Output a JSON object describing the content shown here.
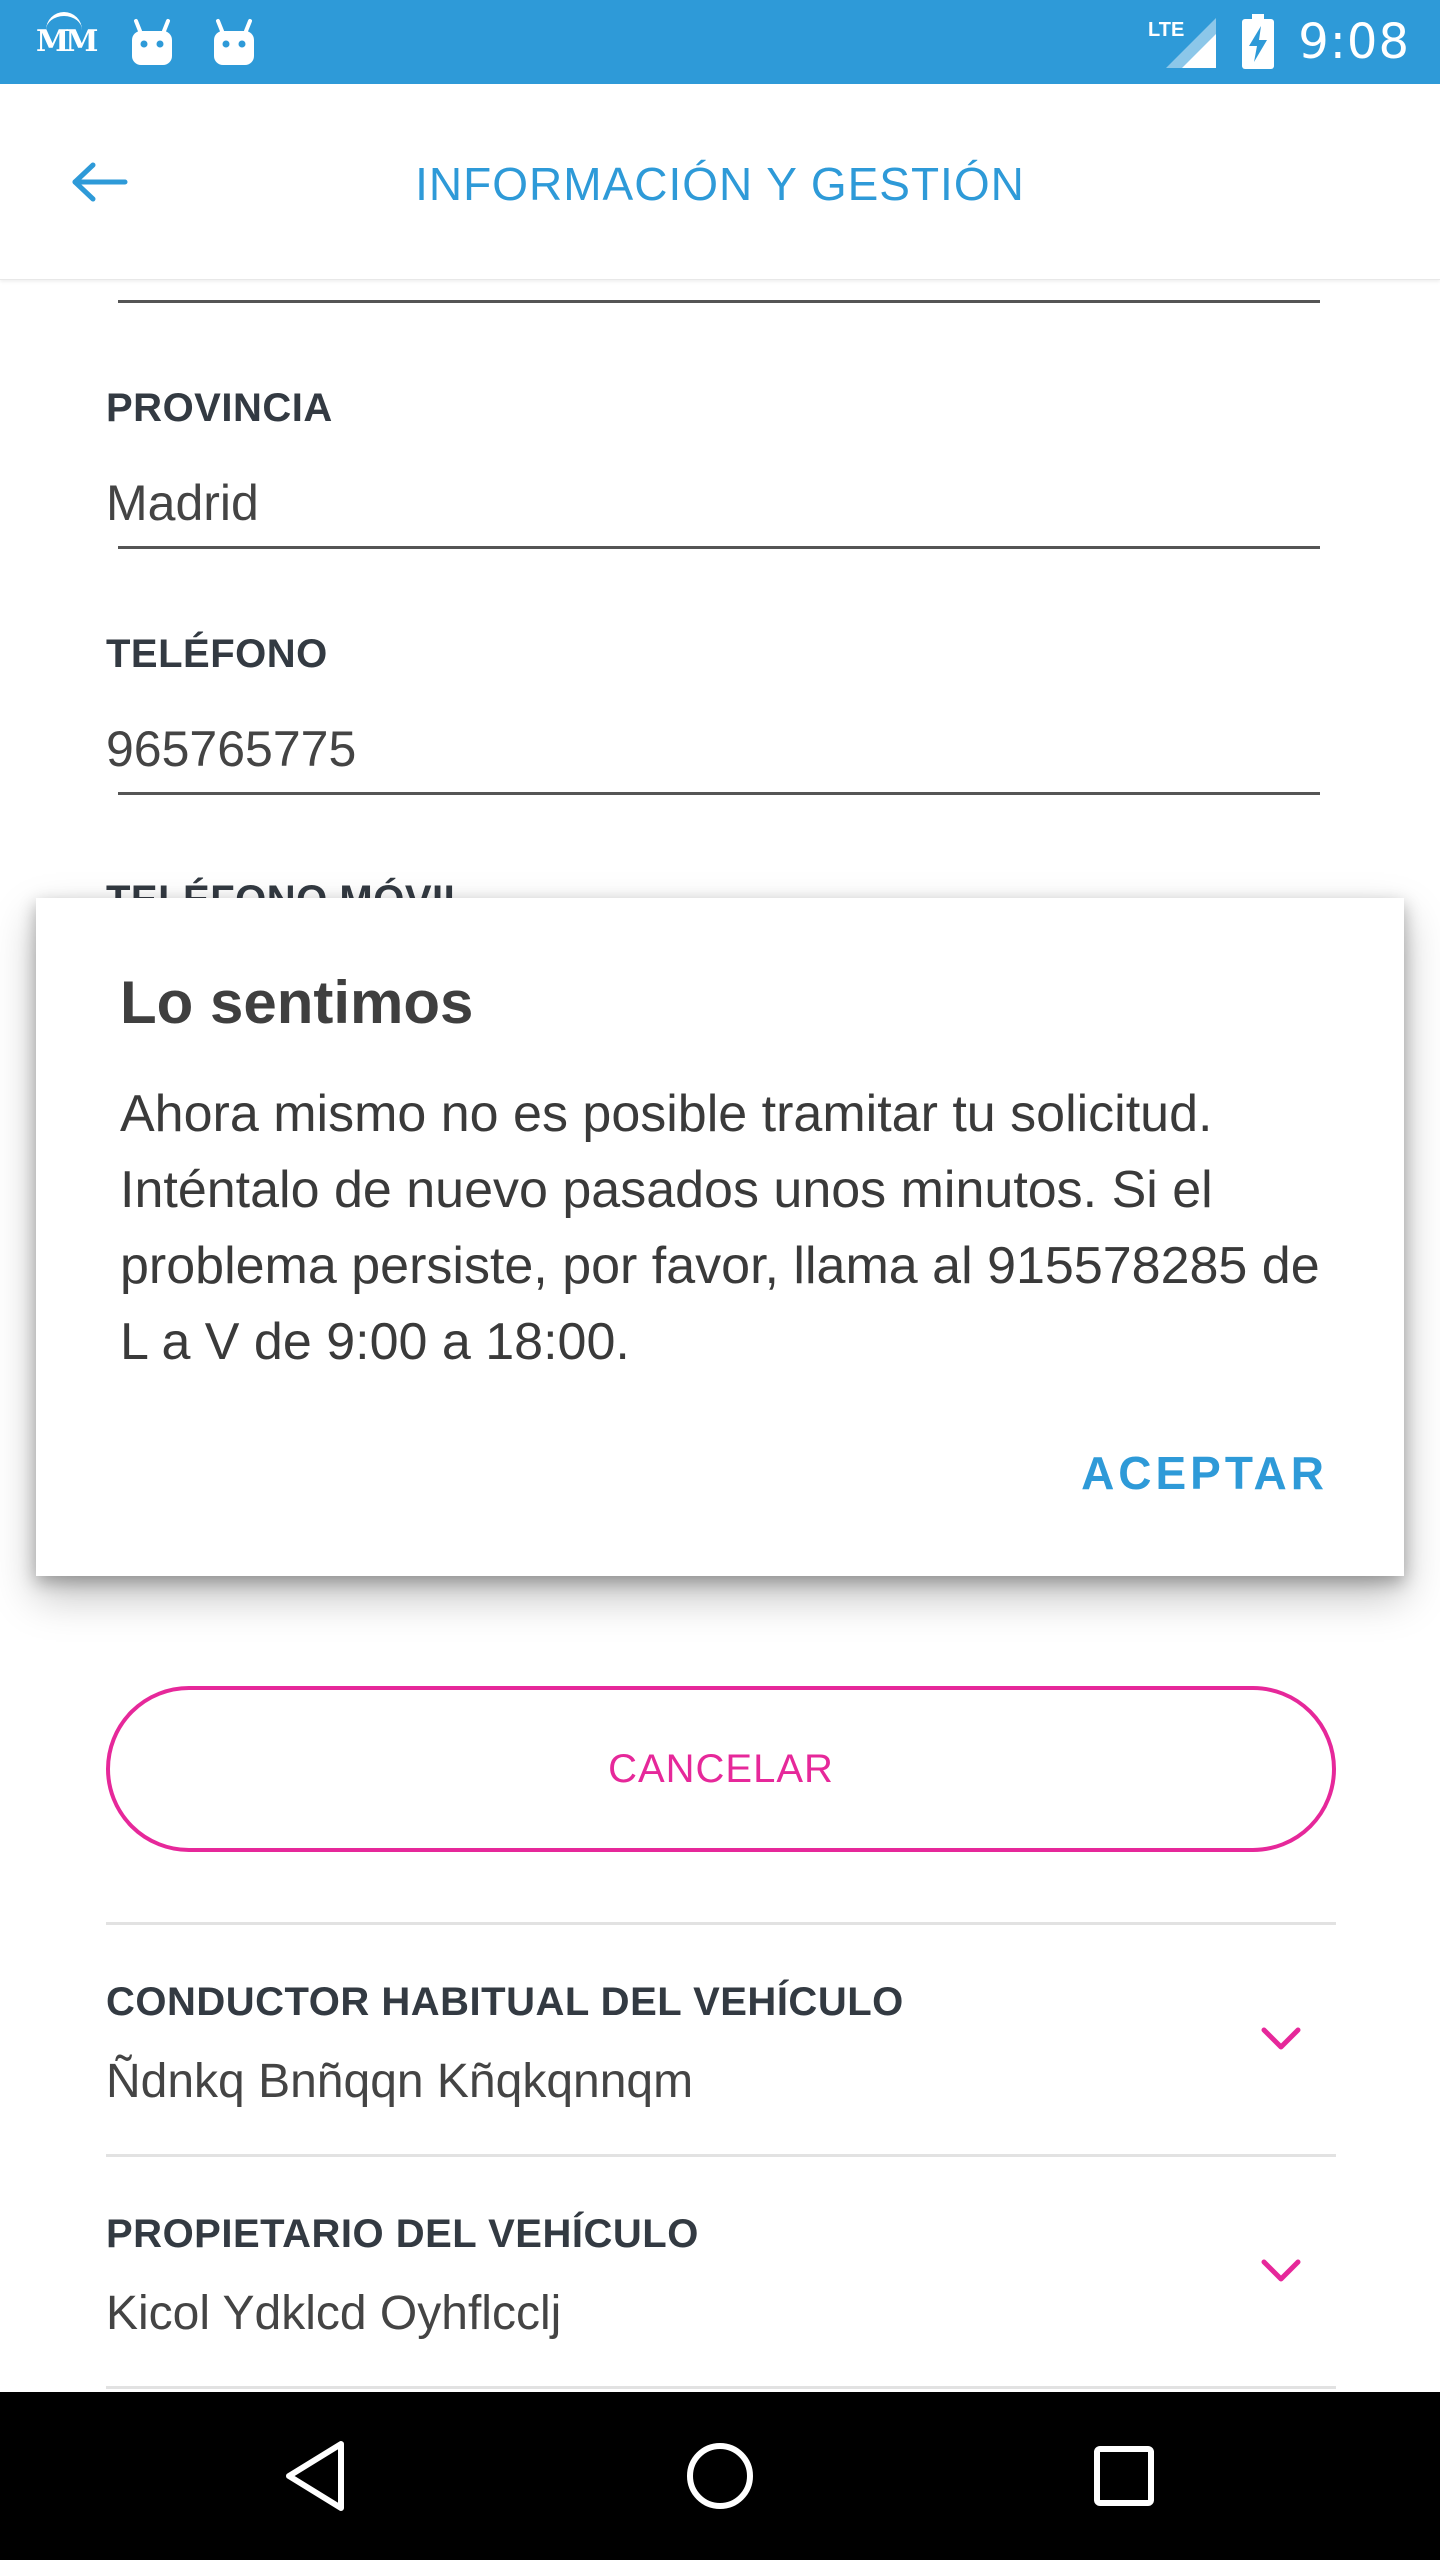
{
  "status_bar": {
    "time": "9:08",
    "network": "LTE",
    "left_icons": [
      "mm-logo-icon",
      "android-icon",
      "android-icon"
    ]
  },
  "header": {
    "title": "INFORMACIÓN Y GESTIÓN",
    "back_icon": "arrow-left-icon"
  },
  "form": {
    "fields": [
      {
        "label": "PROVINCIA",
        "value": "Madrid"
      },
      {
        "label": "TELÉFONO",
        "value": "965765775"
      },
      {
        "label": "TELÉFONO MÓVIL",
        "value": ""
      }
    ]
  },
  "dialog": {
    "title": "Lo sentimos",
    "message": "Ahora mismo no es posible tramitar tu solicitud. Inténtalo de nuevo pasados unos minutos. Si el problema persiste, por favor, llama al 915578285 de L a V de 9:00 a 18:00.",
    "accept_label": "ACEPTAR"
  },
  "cancel_button": {
    "label": "CANCELAR"
  },
  "sections": [
    {
      "title": "CONDUCTOR HABITUAL DEL VEHÍCULO",
      "value": "Ñdnkq Bnñqqn Kñqkqnnqm"
    },
    {
      "title": "PROPIETARIO DEL VEHÍCULO",
      "value": "Kicol Ydklcd Oyhflcclj"
    }
  ],
  "colors": {
    "primary": "#2e9ad8",
    "accent": "#e6289a",
    "text_dark": "#333a42"
  }
}
